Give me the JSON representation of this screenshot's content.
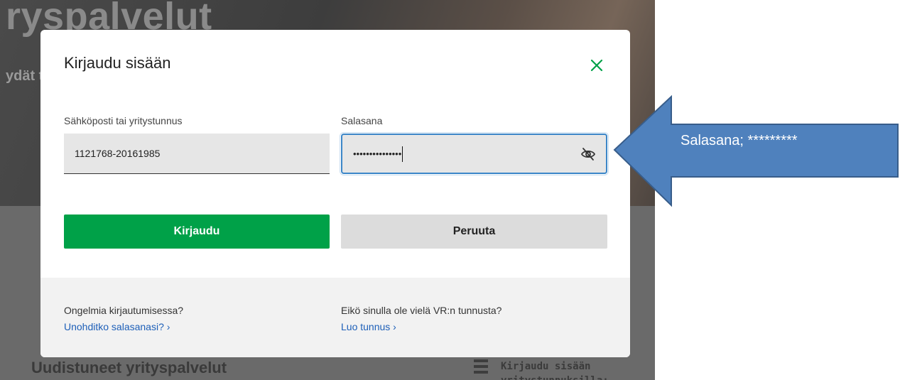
{
  "background": {
    "hero_title": "ryspalvelut",
    "hero_subtitle": "ydät t",
    "section_title": "Uudistuneet yrityspalvelut",
    "right_text_line1": "Kirjaudu sisään",
    "right_text_line2": "yritystunnuksilla:"
  },
  "modal": {
    "title": "Kirjaudu sisään",
    "close_icon": "close-icon",
    "email": {
      "label": "Sähköposti tai yritystunnus",
      "value": "1121768-20161985"
    },
    "password": {
      "label": "Salasana",
      "masked_value": "•••••••••••••••",
      "toggle_icon": "eye-slash-icon"
    },
    "login_label": "Kirjaudu",
    "cancel_label": "Peruuta",
    "footer": {
      "problem_text": "Ongelmia kirjautumisessa?",
      "forgot_link": "Unohditko salasanasi? ›",
      "no_account_text": "Eikö sinulla ole vielä VR:n tunnusta?",
      "create_link": "Luo tunnus ›"
    }
  },
  "annotation": {
    "text": "Salasana; *********"
  },
  "colors": {
    "primary_green": "#00a148",
    "close_green": "#00a148",
    "link_blue": "#1d5fb8",
    "focus_blue": "#3b86c8",
    "arrow_fill": "#4f81bd",
    "arrow_stroke": "#385d8a"
  }
}
